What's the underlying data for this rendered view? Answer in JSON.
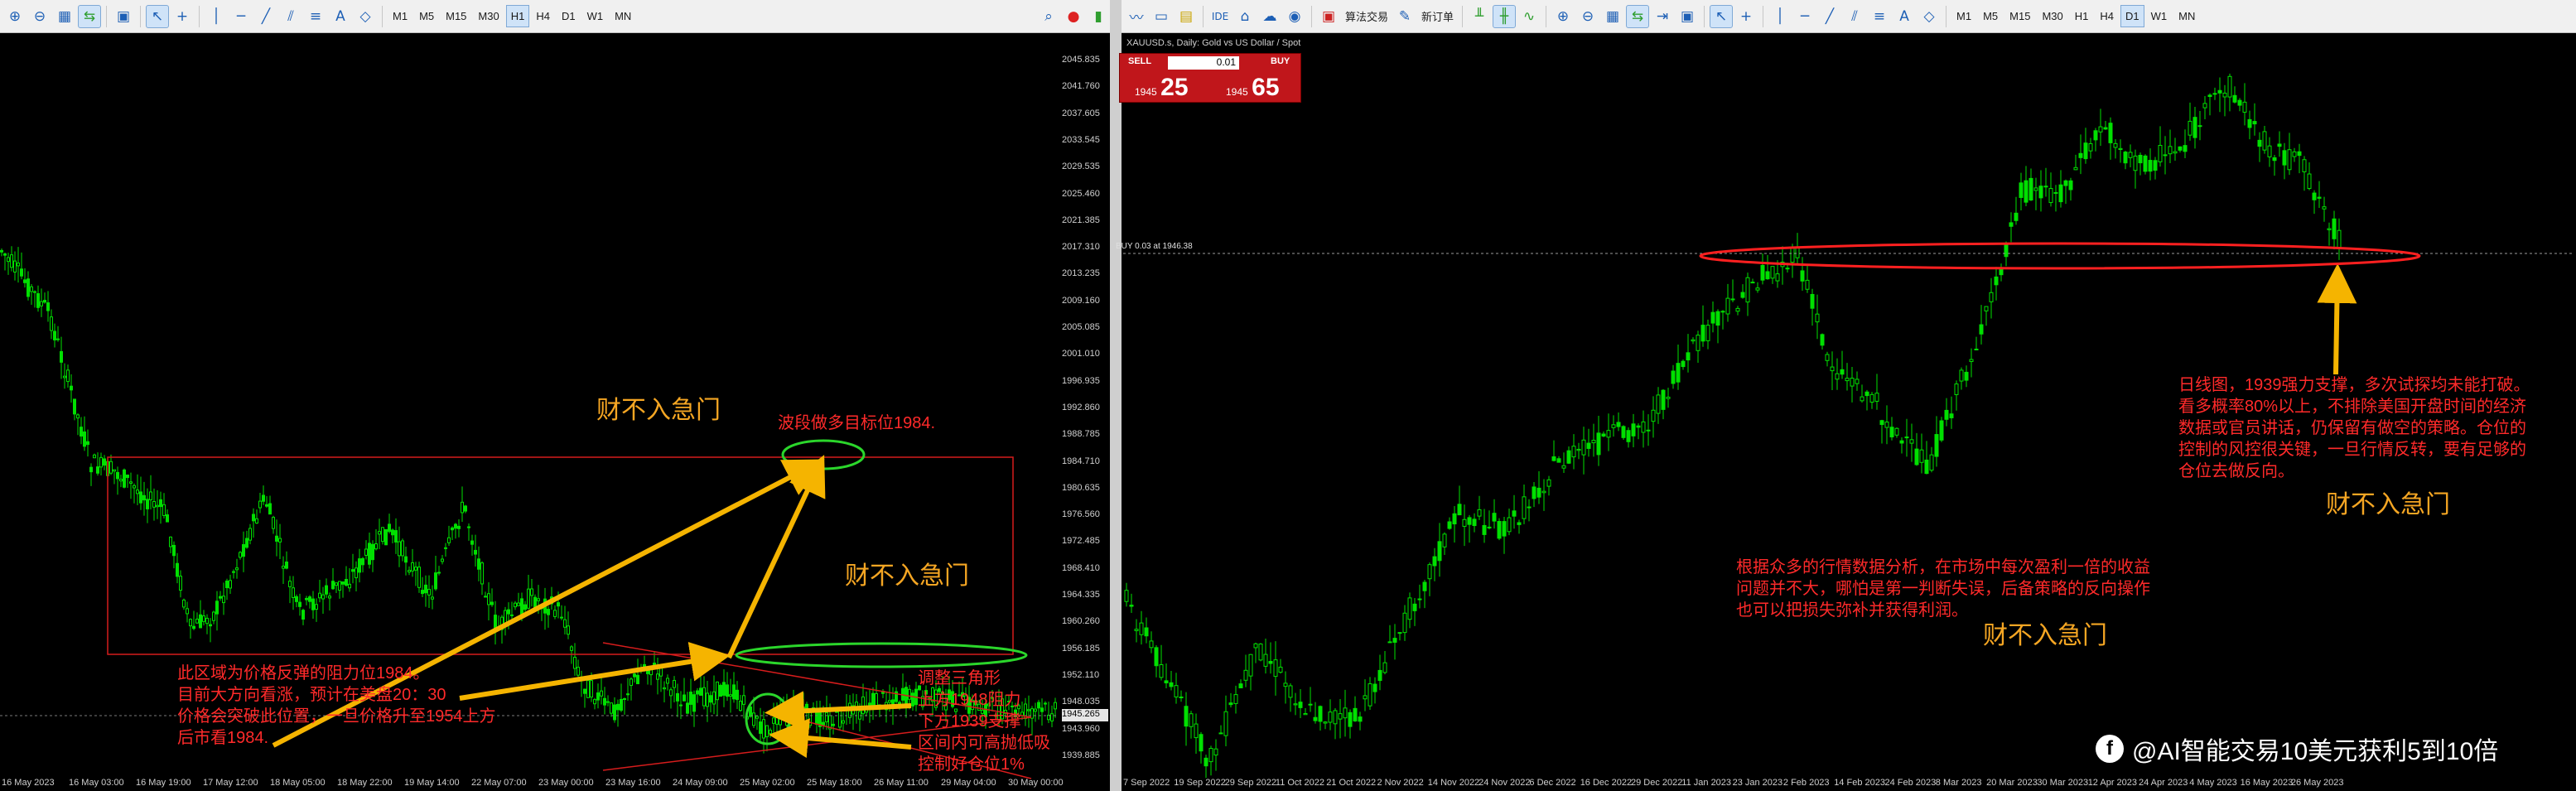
{
  "left_toolbar": {
    "timeframes": [
      "M1",
      "M5",
      "M15",
      "M30",
      "H1",
      "H4",
      "D1",
      "W1",
      "MN"
    ],
    "active_timeframe": "H1"
  },
  "right_toolbar": {
    "algo_trading": "算法交易",
    "new_order": "新订单",
    "timeframes": [
      "M1",
      "M5",
      "M15",
      "M30",
      "H1",
      "H4",
      "D1",
      "W1",
      "MN"
    ],
    "active_timeframe": "D1"
  },
  "left_chart": {
    "price_axis": [
      "2045.835",
      "2041.760",
      "2037.605",
      "2033.545",
      "2029.535",
      "2025.460",
      "2021.385",
      "2017.310",
      "2013.235",
      "2009.160",
      "2005.085",
      "2001.010",
      "1996.935",
      "1992.860",
      "1988.785",
      "1984.710",
      "1980.635",
      "1976.560",
      "1972.485",
      "1968.410",
      "1964.335",
      "1960.260",
      "1956.185",
      "1952.110",
      "1948.035",
      "1943.960",
      "1939.885"
    ],
    "current_price_tag": "1945.265",
    "time_axis": [
      "16 May 2023",
      "16 May 03:00",
      "16 May 19:00",
      "17 May 12:00",
      "18 May 05:00",
      "18 May 22:00",
      "19 May 14:00",
      "22 May 07:00",
      "23 May 00:00",
      "23 May 16:00",
      "24 May 09:00",
      "25 May 02:00",
      "25 May 18:00",
      "26 May 11:00",
      "29 May 04:00",
      "30 May 00:00"
    ],
    "annotations": {
      "target": "波段做多目标位1984.",
      "resistance": "此区域为价格反弹的阻力位1984。\n目前大方向看涨，预计在美盘20：30\n价格会突破此位置，一旦价格升至1954上方\n后市看1984.",
      "triangle": "调整三角形\n上方1948阻力\n下方1939支撑\n区间内可高抛低吸\n控制好仓位1%"
    },
    "slogans": [
      "财不入急门",
      "财不入急门"
    ]
  },
  "right_chart": {
    "symbol_title": "XAUUSD.s, Daily: Gold vs US Dollar / Spot",
    "order_line": "BUY 0.03 at 1946.38",
    "trade_panel": {
      "sell": "SELL",
      "buy": "BUY",
      "lot": "0.01",
      "sell_prefix": "1945",
      "sell_big": "25",
      "buy_prefix": "1945",
      "buy_big": "65"
    },
    "time_axis": [
      "7 Sep 2022",
      "19 Sep 2022",
      "29 Sep 2022",
      "11 Oct 2022",
      "21 Oct 2022",
      "2 Nov 2022",
      "14 Nov 2022",
      "24 Nov 2022",
      "6 Dec 2022",
      "16 Dec 2022",
      "29 Dec 2022",
      "11 Jan 2023",
      "23 Jan 2023",
      "2 Feb 2023",
      "14 Feb 2023",
      "24 Feb 2023",
      "8 Mar 2023",
      "20 Mar 2023",
      "30 Mar 2023",
      "12 Apr 2023",
      "24 Apr 2023",
      "4 May 2023",
      "16 May 2023",
      "26 May 2023"
    ],
    "annotations": {
      "daily": "日线图，1939强力支撑，多次试探均未能打破。\n看多概率80%以上，不排除美国开盘时间的经济\n数据或官员讲话，仍保留有做空的策略。仓位的\n控制的风控很关键，一旦行情反转，要有足够的\n仓位去做反向。",
      "analysis": "根据众多的行情数据分析，在市场中每次盈利一倍的收益\n问题并不大，哪怕是第一判断失误，后备策略的反向操作\n也可以把损失弥补并获得利润。"
    },
    "slogans": [
      "财不入急门",
      "财不入急门"
    ]
  },
  "watermark": "@AI智能交易10美元获利5到10倍",
  "colors": {
    "annotation": "#ff2a2a",
    "slogan": "#f5a623",
    "candle": "#00e000",
    "arrow": "#f5b400",
    "ellipse_green": "#2bd62b",
    "ellipse_red": "#ff2020"
  }
}
